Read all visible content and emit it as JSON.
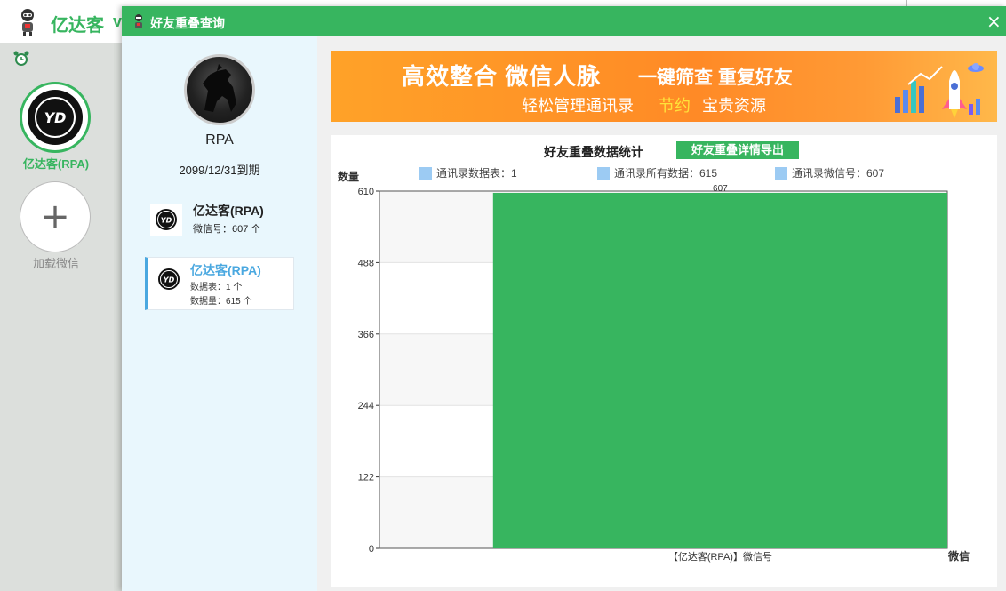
{
  "app": {
    "title": "亿达客",
    "version_fragment": "v",
    "account_label": "亿达客(RPA)",
    "add_label": "加载微信",
    "add_symbol": "+",
    "brand_green": "#37b55f"
  },
  "dialog": {
    "title": "好友重叠查询",
    "close_symbol": "×",
    "profile": {
      "name": "RPA",
      "expire": "2099/12/31到期"
    },
    "list": [
      {
        "name": "亿达客(RPA)",
        "sub1": "微信号：607 个"
      },
      {
        "name": "亿达客(RPA)",
        "sub1": "数据表：1 个",
        "sub2": "数据量：615 个"
      }
    ],
    "logo_text": "YD",
    "banner": {
      "title": "高效整合 微信人脉",
      "title2": "一键筛查 重复好友",
      "sub": "轻松管理通讯录",
      "highlight": "节约",
      "sub2": "宝贵资源"
    }
  },
  "chart_panel": {
    "title": "好友重叠数据统计",
    "export_label": "好友重叠详情导出",
    "legend": [
      {
        "label": "通讯录数据表：1"
      },
      {
        "label": "通讯录所有数据：615"
      },
      {
        "label": "通讯录微信号：607"
      }
    ]
  },
  "chart_data": {
    "type": "bar",
    "ylabel": "数量",
    "xlabel": "微信",
    "ylim": [
      0,
      610
    ],
    "yticks": [
      0,
      122,
      244,
      366,
      488,
      610
    ],
    "categories": [
      "【亿达客(RPA)】微信号"
    ],
    "values": [
      607
    ],
    "bar_color": "#37b55f",
    "grid": true
  }
}
